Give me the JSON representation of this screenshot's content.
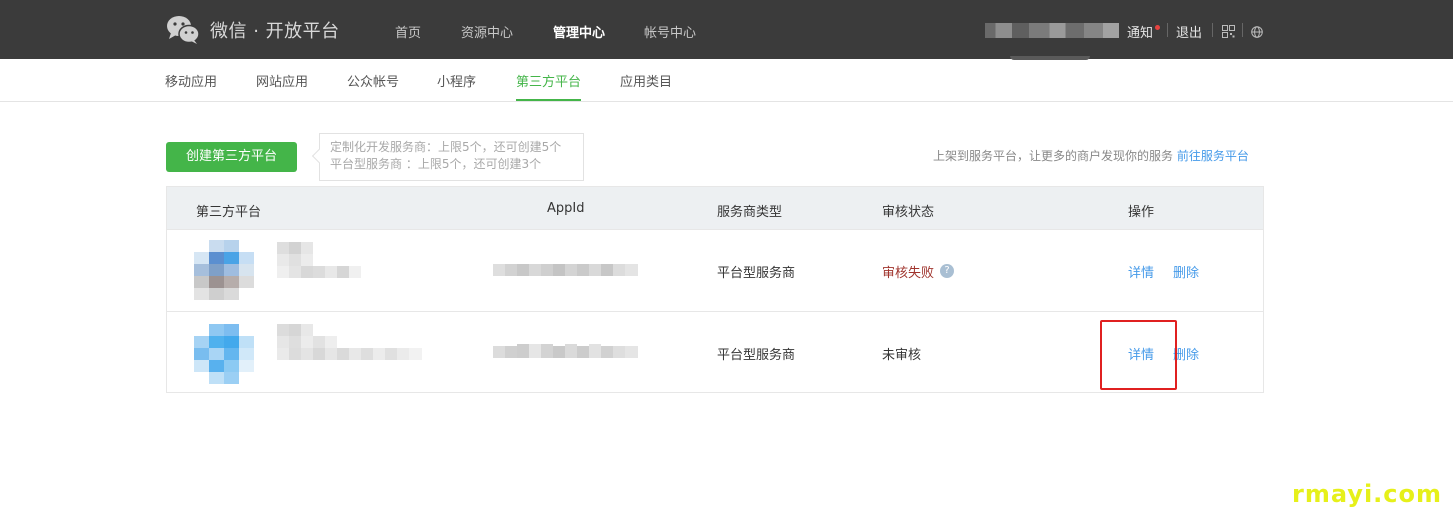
{
  "topbar": {
    "brand_title": "微信 · 开放平台",
    "nav": [
      "首页",
      "资源中心",
      "管理中心",
      "帐号中心"
    ],
    "active_nav": "管理中心",
    "notice_label": "通知",
    "logout_label": "退出",
    "icons": [
      "wechat-logo-icon",
      "qrcode-icon",
      "globe-icon"
    ]
  },
  "subnav": {
    "items": [
      "移动应用",
      "网站应用",
      "公众帐号",
      "小程序",
      "第三方平台",
      "应用类目"
    ],
    "active": "第三方平台"
  },
  "actions": {
    "create_label": "创建第三方平台",
    "quota_line1": "定制化开发服务商：上限5个，还可创建5个",
    "quota_line2": "平台型服务商 ：上限5个，还可创建3个",
    "promo_text": "上架到服务平台，让更多的商户发现你的服务",
    "promo_link": "前往服务平台"
  },
  "table": {
    "headers": [
      "第三方平台",
      "AppId",
      "服务商类型",
      "审核状态",
      "操作"
    ],
    "rows": [
      {
        "type": "平台型服务商",
        "status": "审核失败",
        "detail": "详情",
        "delete": "删除"
      },
      {
        "type": "平台型服务商",
        "status": "未审核",
        "detail": "详情",
        "delete": "删除"
      }
    ]
  },
  "colors": {
    "accent": "#44b549",
    "link": "#459ae9",
    "fail": "#a0342d",
    "highlight": "#e02020"
  },
  "watermark": "rmayi.com"
}
